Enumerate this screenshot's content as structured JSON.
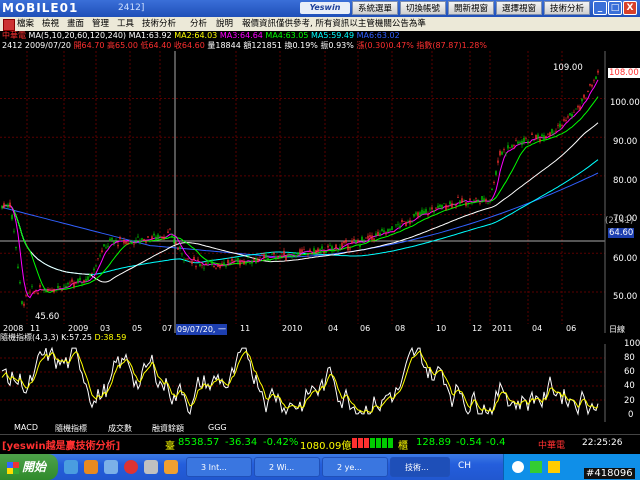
{
  "window": {
    "logo": "MOBILE01",
    "code_fragment": "2412]",
    "brand_button": "Yeswin",
    "buttons": [
      "系統選單",
      "切換帳號",
      "開新視窗",
      "選擇視窗",
      "技術分析"
    ],
    "controls": [
      "_",
      "□",
      "X"
    ]
  },
  "menu": [
    "檔案",
    "檢視",
    "畫面",
    "管理",
    "工具",
    "技術分析",
    "分析",
    "說明",
    "報價資訊僅供參考, 所有資訊以主管機關公告為準"
  ],
  "info_line1": {
    "name": "中華電",
    "ma_settings": "MA(5,10,20,60,120,240)",
    "ma1": "MA1:63.92",
    "ma2": "MA2:64.03",
    "ma3": "MA3:64.64",
    "ma4": "MA4:63.05",
    "ma5": "MA5:59.49",
    "ma6": "MA6:63.02"
  },
  "info_line2": {
    "code": "2412",
    "date": "2009/07/20",
    "open": "開64.70",
    "high": "高65.00",
    "low": "低64.40",
    "close": "收64.60",
    "volume": "量18844",
    "amount": "額121851",
    "turnover": "換0.19%",
    "amplitude": "振0.93%",
    "change": "漲(0.30)0.47%",
    "index": "指數(87.87)1.28%"
  },
  "price_axis": [
    "108.00",
    "100.00",
    "90.00",
    "80.00",
    "70.00",
    "64.60",
    "60.00",
    "50.00"
  ],
  "annotations": {
    "high": "109.00",
    "low": "45.60",
    "volume_tag": "(2141)",
    "crosshair_price": "64.60"
  },
  "time_axis": {
    "labels": [
      "2008",
      "11",
      "2009",
      "03",
      "05",
      "07",
      "09/07/20, 一",
      "11",
      "2010",
      "04",
      "06",
      "08",
      "10",
      "12",
      "2011",
      "04",
      "06"
    ],
    "unit": "日線"
  },
  "indicator": {
    "title": "隨機指標(4,3,3)",
    "k": "K:57.25",
    "d": "D:38.59",
    "axis": [
      "100",
      "80",
      "60",
      "40",
      "20",
      "0"
    ]
  },
  "tabs": [
    "MACD",
    "隨機指標",
    "成交數",
    "融資餘額",
    "GGG"
  ],
  "ticker": {
    "brand": "[yeswin越是贏技術分析]",
    "taiex_label": "臺",
    "taiex": "8538.57",
    "taiex_change": "-36.34",
    "taiex_pct": "-0.42%",
    "taiex_vol": "1080.09億",
    "otc_label": "櫃",
    "otc": "128.89",
    "otc_change": "-0.54",
    "otc_pct": "-0.4",
    "stock_tag": "中華電",
    "time": "22:25:26"
  },
  "taskbar": {
    "start": "開始",
    "tasks": [
      "3 Int...",
      "2 Wi...",
      "2 ye...",
      "技術..."
    ],
    "lang": "CH",
    "watermark": "#418096"
  },
  "colors": {
    "up": "#ff3030",
    "down": "#00cc00",
    "ma1": "#ffffff",
    "ma2": "#ffff00",
    "ma3": "#ff00ff",
    "ma4": "#00ff00",
    "ma5": "#00ffff",
    "ma6": "#3060ff"
  }
}
